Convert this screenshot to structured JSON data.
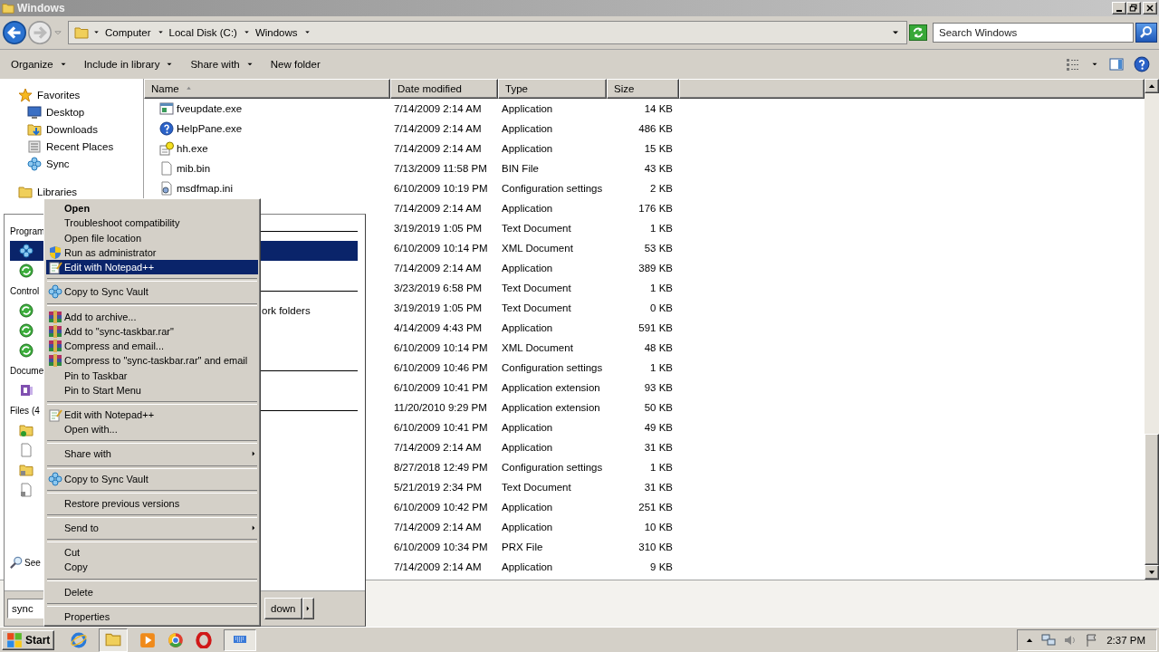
{
  "window": {
    "title": "Windows"
  },
  "address_bar": {
    "crumbs": [
      "Computer",
      "Local Disk (C:)",
      "Windows"
    ]
  },
  "search": {
    "placeholder": "Search Windows"
  },
  "toolbar": {
    "buttons": [
      {
        "label": "Organize",
        "dropdown": true
      },
      {
        "label": "Include in library",
        "dropdown": true
      },
      {
        "label": "Share with",
        "dropdown": true
      },
      {
        "label": "New folder",
        "dropdown": false
      }
    ]
  },
  "nav": {
    "items": [
      {
        "label": "Favorites",
        "kind": "group"
      },
      {
        "label": "Desktop",
        "kind": "item"
      },
      {
        "label": "Downloads",
        "kind": "item"
      },
      {
        "label": "Recent Places",
        "kind": "item"
      },
      {
        "label": "Sync",
        "kind": "item"
      },
      {
        "label": "Libraries",
        "kind": "group"
      }
    ]
  },
  "file_list": {
    "columns": [
      {
        "label": "Name",
        "sorted": true
      },
      {
        "label": "Date modified",
        "sorted": false
      },
      {
        "label": "Type",
        "sorted": false
      },
      {
        "label": "Size",
        "sorted": false
      }
    ],
    "rows": [
      {
        "name": "fveupdate.exe",
        "date": "7/14/2009 2:14 AM",
        "type": "Application",
        "size": "14 KB"
      },
      {
        "name": "HelpPane.exe",
        "date": "7/14/2009 2:14 AM",
        "type": "Application",
        "size": "486 KB"
      },
      {
        "name": "hh.exe",
        "date": "7/14/2009 2:14 AM",
        "type": "Application",
        "size": "15 KB"
      },
      {
        "name": "mib.bin",
        "date": "7/13/2009 11:58 PM",
        "type": "BIN File",
        "size": "43 KB"
      },
      {
        "name": "msdfmap.ini",
        "date": "6/10/2009 10:19 PM",
        "type": "Configuration settings",
        "size": "2 KB"
      },
      {
        "date": "7/14/2009 2:14 AM",
        "type": "Application",
        "size": "176 KB"
      },
      {
        "date": "3/19/2019 1:05 PM",
        "type": "Text Document",
        "size": "1 KB"
      },
      {
        "date": "6/10/2009 10:14 PM",
        "type": "XML Document",
        "size": "53 KB"
      },
      {
        "date": "7/14/2009 2:14 AM",
        "type": "Application",
        "size": "389 KB"
      },
      {
        "date": "3/23/2019 6:58 PM",
        "type": "Text Document",
        "size": "1 KB"
      },
      {
        "date": "3/19/2019 1:05 PM",
        "type": "Text Document",
        "size": "0 KB"
      },
      {
        "date": "4/14/2009 4:43 PM",
        "type": "Application",
        "size": "591 KB"
      },
      {
        "date": "6/10/2009 10:14 PM",
        "type": "XML Document",
        "size": "48 KB"
      },
      {
        "date": "6/10/2009 10:46 PM",
        "type": "Configuration settings",
        "size": "1 KB"
      },
      {
        "date": "6/10/2009 10:41 PM",
        "type": "Application extension",
        "size": "93 KB"
      },
      {
        "date": "11/20/2010 9:29 PM",
        "type": "Application extension",
        "size": "50 KB"
      },
      {
        "date": "6/10/2009 10:41 PM",
        "type": "Application",
        "size": "49 KB"
      },
      {
        "date": "7/14/2009 2:14 AM",
        "type": "Application",
        "size": "31 KB"
      },
      {
        "date": "8/27/2018 12:49 PM",
        "type": "Configuration settings",
        "size": "1 KB"
      },
      {
        "date": "5/21/2019 2:34 PM",
        "type": "Text Document",
        "size": "31 KB"
      },
      {
        "date": "6/10/2009 10:42 PM",
        "type": "Application",
        "size": "251 KB"
      },
      {
        "date": "7/14/2009 2:14 AM",
        "type": "Application",
        "size": "10 KB"
      },
      {
        "date": "6/10/2009 10:34 PM",
        "type": "PRX File",
        "size": "310 KB"
      },
      {
        "date": "7/14/2009 2:14 AM",
        "type": "Application",
        "size": "9 KB"
      }
    ]
  },
  "start_menu": {
    "sections": [
      {
        "title": "Program",
        "items": [
          {
            "selected": true
          },
          {
            "selected": false
          }
        ]
      },
      {
        "title": "Control",
        "items": [
          {
            "selected": false,
            "text": "ork folders"
          },
          {
            "selected": false
          },
          {
            "selected": false
          }
        ]
      },
      {
        "title": "Docume",
        "items": [
          {
            "selected": false
          }
        ]
      },
      {
        "title": "Files (4",
        "items": [
          {
            "selected": false
          },
          {
            "selected": false
          },
          {
            "selected": false
          },
          {
            "selected": false
          }
        ]
      }
    ],
    "see_more": "See",
    "search_box": {
      "value": "sync"
    },
    "power_button": {
      "label": "down"
    }
  },
  "context_menu": {
    "groups": [
      [
        {
          "label": "Open",
          "default": true,
          "selected": false,
          "submenu": false
        },
        {
          "label": "Troubleshoot compatibility",
          "default": false,
          "selected": false,
          "submenu": false
        },
        {
          "label": "Open file location",
          "default": false,
          "selected": false,
          "submenu": false
        },
        {
          "label": "Run as administrator",
          "default": false,
          "selected": false,
          "submenu": false
        },
        {
          "label": "Edit with Notepad++",
          "default": false,
          "selected": true,
          "submenu": false
        }
      ],
      [
        {
          "label": "Copy to Sync Vault",
          "default": false,
          "selected": false,
          "submenu": false
        }
      ],
      [
        {
          "label": "Add to archive...",
          "default": false,
          "selected": false,
          "submenu": false
        },
        {
          "label": "Add to \"sync-taskbar.rar\"",
          "default": false,
          "selected": false,
          "submenu": false
        },
        {
          "label": "Compress and email...",
          "default": false,
          "selected": false,
          "submenu": false
        },
        {
          "label": "Compress to \"sync-taskbar.rar\" and email",
          "default": false,
          "selected": false,
          "submenu": false
        },
        {
          "label": "Pin to Taskbar",
          "default": false,
          "selected": false,
          "submenu": false
        },
        {
          "label": "Pin to Start Menu",
          "default": false,
          "selected": false,
          "submenu": false
        }
      ],
      [
        {
          "label": "Edit with Notepad++",
          "default": false,
          "selected": false,
          "submenu": false
        },
        {
          "label": "Open with...",
          "default": false,
          "selected": false,
          "submenu": false
        }
      ],
      [
        {
          "label": "Share with",
          "default": false,
          "selected": false,
          "submenu": true
        }
      ],
      [
        {
          "label": "Copy to Sync Vault",
          "default": false,
          "selected": false,
          "submenu": false
        }
      ],
      [
        {
          "label": "Restore previous versions",
          "default": false,
          "selected": false,
          "submenu": false
        }
      ],
      [
        {
          "label": "Send to",
          "default": false,
          "selected": false,
          "submenu": true
        }
      ],
      [
        {
          "label": "Cut",
          "default": false,
          "selected": false,
          "submenu": false
        },
        {
          "label": "Copy",
          "default": false,
          "selected": false,
          "submenu": false
        }
      ],
      [
        {
          "label": "Delete",
          "default": false,
          "selected": false,
          "submenu": false
        }
      ],
      [
        {
          "label": "Properties",
          "default": false,
          "selected": false,
          "submenu": false
        }
      ]
    ]
  },
  "taskbar": {
    "start": "Start",
    "clock": "2:37 PM"
  }
}
